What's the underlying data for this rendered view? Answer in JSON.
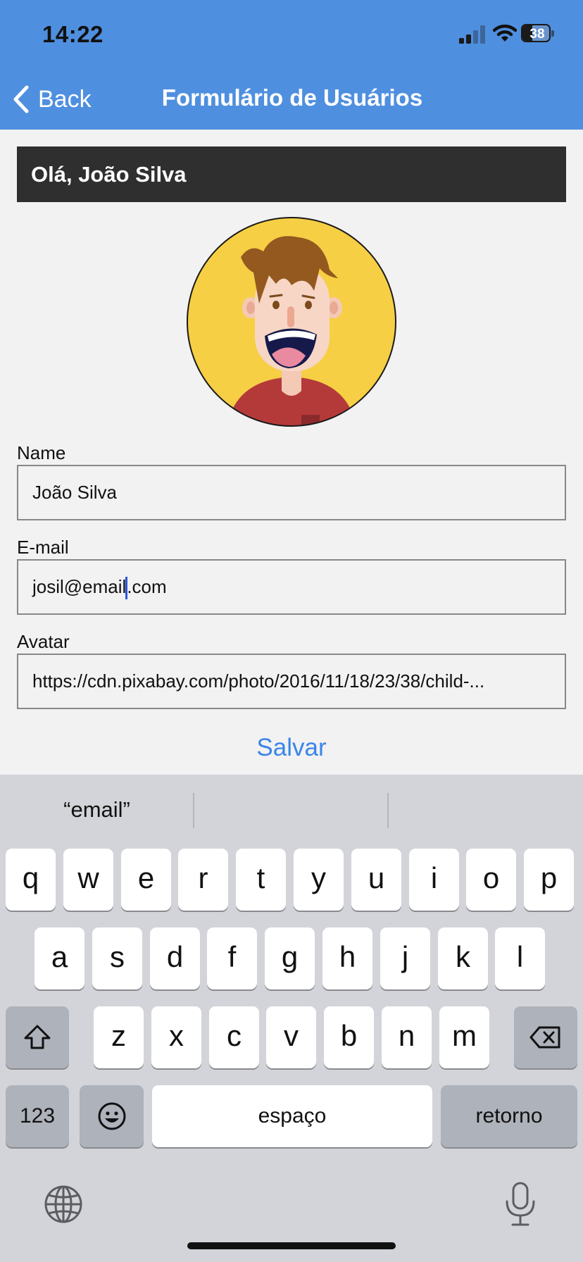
{
  "status_bar": {
    "time": "14:22",
    "battery_level": "38",
    "battery_fraction": 0.38,
    "signal_bars_active": 2,
    "icons": [
      "signal-icon",
      "wifi-icon",
      "battery-icon"
    ]
  },
  "nav": {
    "back_label": "Back",
    "title": "Formulário de Usuários"
  },
  "greeting": "Olá, João Silva",
  "form": {
    "name_label": "Name",
    "name_value": "João Silva",
    "email_label": "E-mail",
    "email_before_caret": "josil@email",
    "email_after_caret": ".com",
    "avatar_label": "Avatar",
    "avatar_value": "https://cdn.pixabay.com/photo/2016/11/18/23/38/child-..."
  },
  "save_label": "Salvar",
  "keyboard": {
    "suggestions": [
      "“email”",
      "",
      ""
    ],
    "row1": [
      "q",
      "w",
      "e",
      "r",
      "t",
      "y",
      "u",
      "i",
      "o",
      "p"
    ],
    "row2": [
      "a",
      "s",
      "d",
      "f",
      "g",
      "h",
      "j",
      "k",
      "l"
    ],
    "row3": [
      "z",
      "x",
      "c",
      "v",
      "b",
      "n",
      "m"
    ],
    "numbers_label": "123",
    "space_label": "espaço",
    "return_label": "retorno"
  },
  "colors": {
    "header": "#4f8fdf",
    "accent": "#3a85e8",
    "greeting_bg": "#2f2f2f",
    "avatar_bg": "#f6cf45"
  }
}
